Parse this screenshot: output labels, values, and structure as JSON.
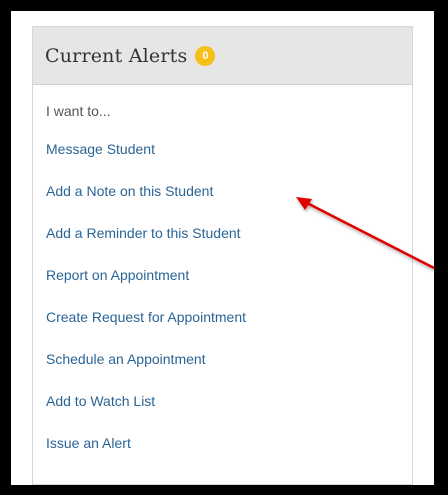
{
  "panel": {
    "title": "Current Alerts",
    "alert_count": "0",
    "intro": "I want to..."
  },
  "menu": {
    "items": [
      {
        "label": "Message Student"
      },
      {
        "label": "Add a Note on this Student"
      },
      {
        "label": "Add a Reminder to this Student"
      },
      {
        "label": "Report on Appointment"
      },
      {
        "label": "Create Request for Appointment"
      },
      {
        "label": "Schedule an Appointment"
      },
      {
        "label": "Add to Watch List"
      },
      {
        "label": "Issue an Alert"
      }
    ]
  },
  "colors": {
    "link": "#2a6496",
    "badge": "#f5c018",
    "annotation_arrow": "#e00000"
  }
}
